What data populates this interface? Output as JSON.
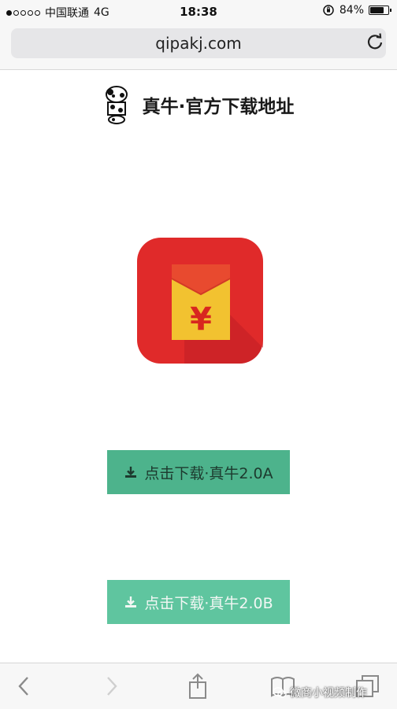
{
  "status_bar": {
    "carrier": "中国联通",
    "network": "4G",
    "time": "18:38",
    "battery_text": "84%",
    "battery_level": 0.84,
    "signal_bars_filled": 1,
    "signal_bars_total": 5
  },
  "browser": {
    "url": "qipakj.com"
  },
  "page": {
    "title": "真牛·官方下载地址",
    "buttons": [
      {
        "label": "点击下载·真牛2.0A"
      },
      {
        "label": "点击下载·真牛2.0B"
      }
    ]
  },
  "watermark": {
    "text": "微商小视频制作"
  },
  "colors": {
    "button_green": "#4db38c",
    "icon_red": "#e02a2a",
    "envelope_yellow": "#f2c230"
  },
  "icons": {
    "reload": "reload-icon",
    "back": "back-arrow-icon",
    "forward": "forward-arrow-icon",
    "share": "share-icon",
    "bookmarks": "bookmarks-icon",
    "tabs": "tabs-icon",
    "download": "download-icon",
    "app": "red-envelope-yuan-icon"
  }
}
